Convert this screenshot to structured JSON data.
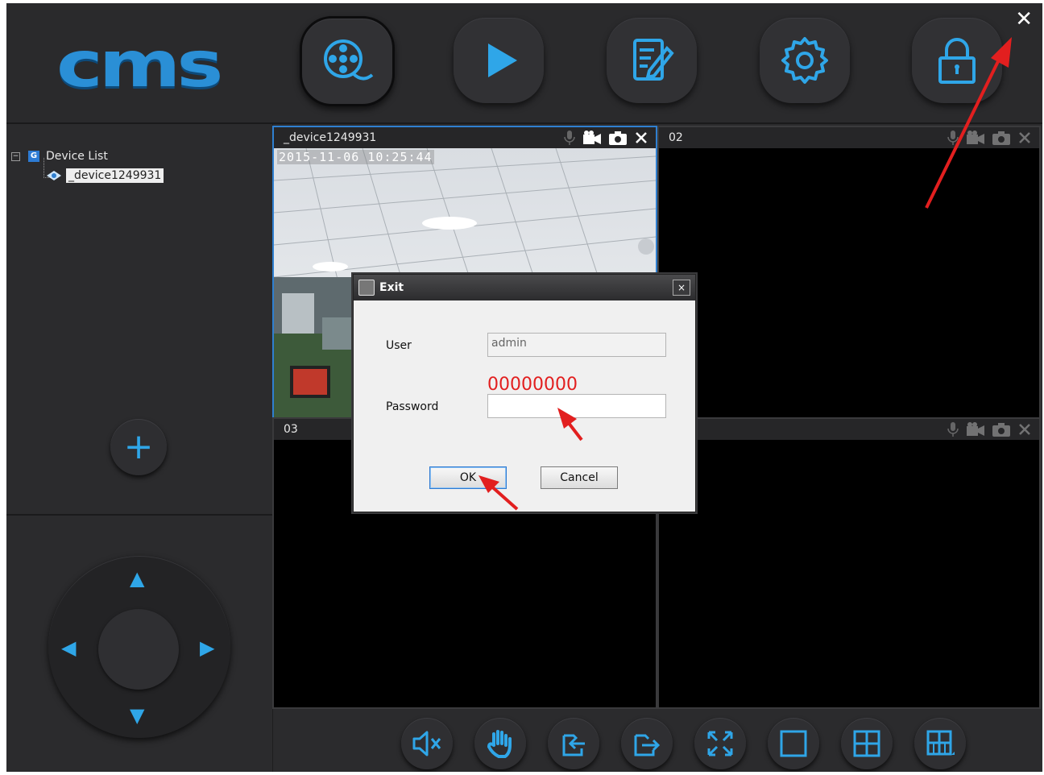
{
  "app": {
    "logo_text": "cms",
    "close_symbol": "✕"
  },
  "toolbar": {
    "buttons": [
      {
        "name": "video-reel-icon",
        "active": true
      },
      {
        "name": "play-icon",
        "active": false
      },
      {
        "name": "edit-document-icon",
        "active": false
      },
      {
        "name": "gear-icon",
        "active": false
      },
      {
        "name": "lock-icon",
        "active": false
      }
    ]
  },
  "sidebar": {
    "tree_root_label": "Device List",
    "tree_root_badge": "G",
    "tree_expander": "−",
    "device_label": "_device1249931",
    "add_symbol": "+",
    "ptz_arrows": {
      "up": "▲",
      "down": "▼",
      "left": "◀",
      "right": "▶"
    }
  },
  "panes": [
    {
      "title": "_device1249931",
      "timestamp": "2015-11-06  10:25:44",
      "active": true
    },
    {
      "title": "02",
      "active": false
    },
    {
      "title": "03",
      "active": false
    },
    {
      "title": "",
      "active": false
    }
  ],
  "pane_icons": [
    "microphone-icon",
    "video-camera-icon",
    "camera-icon",
    "close-icon"
  ],
  "bottom_bar": {
    "buttons": [
      "mute-icon",
      "hand-icon",
      "import-icon",
      "export-icon",
      "fullscreen-icon",
      "single-view-icon",
      "four-view-icon",
      "nine-view-icon"
    ]
  },
  "dialog": {
    "title": "Exit",
    "close_symbol": "×",
    "user_label": "User",
    "user_value": "admin",
    "password_label": "Password",
    "password_value": "",
    "password_annotation": "00000000",
    "ok_label": "OK",
    "cancel_label": "Cancel"
  },
  "colors": {
    "accent": "#2fa6e8",
    "background": "#2b2b2d",
    "annotation_red": "#e21f1f"
  }
}
